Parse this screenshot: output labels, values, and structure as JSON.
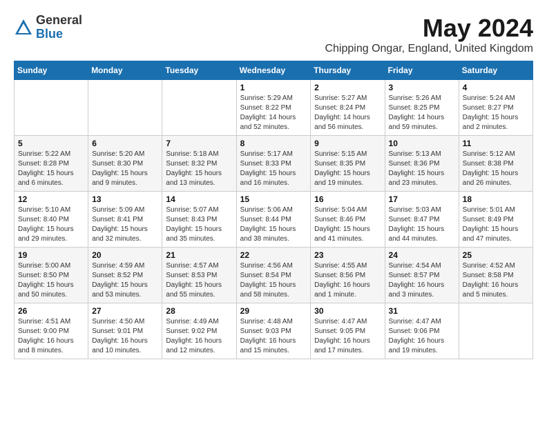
{
  "header": {
    "logo_general": "General",
    "logo_blue": "Blue",
    "title": "May 2024",
    "subtitle": "Chipping Ongar, England, United Kingdom"
  },
  "days_of_week": [
    "Sunday",
    "Monday",
    "Tuesday",
    "Wednesday",
    "Thursday",
    "Friday",
    "Saturday"
  ],
  "weeks": [
    [
      {
        "day": "",
        "info": ""
      },
      {
        "day": "",
        "info": ""
      },
      {
        "day": "",
        "info": ""
      },
      {
        "day": "1",
        "info": "Sunrise: 5:29 AM\nSunset: 8:22 PM\nDaylight: 14 hours\nand 52 minutes."
      },
      {
        "day": "2",
        "info": "Sunrise: 5:27 AM\nSunset: 8:24 PM\nDaylight: 14 hours\nand 56 minutes."
      },
      {
        "day": "3",
        "info": "Sunrise: 5:26 AM\nSunset: 8:25 PM\nDaylight: 14 hours\nand 59 minutes."
      },
      {
        "day": "4",
        "info": "Sunrise: 5:24 AM\nSunset: 8:27 PM\nDaylight: 15 hours\nand 2 minutes."
      }
    ],
    [
      {
        "day": "5",
        "info": "Sunrise: 5:22 AM\nSunset: 8:28 PM\nDaylight: 15 hours\nand 6 minutes."
      },
      {
        "day": "6",
        "info": "Sunrise: 5:20 AM\nSunset: 8:30 PM\nDaylight: 15 hours\nand 9 minutes."
      },
      {
        "day": "7",
        "info": "Sunrise: 5:18 AM\nSunset: 8:32 PM\nDaylight: 15 hours\nand 13 minutes."
      },
      {
        "day": "8",
        "info": "Sunrise: 5:17 AM\nSunset: 8:33 PM\nDaylight: 15 hours\nand 16 minutes."
      },
      {
        "day": "9",
        "info": "Sunrise: 5:15 AM\nSunset: 8:35 PM\nDaylight: 15 hours\nand 19 minutes."
      },
      {
        "day": "10",
        "info": "Sunrise: 5:13 AM\nSunset: 8:36 PM\nDaylight: 15 hours\nand 23 minutes."
      },
      {
        "day": "11",
        "info": "Sunrise: 5:12 AM\nSunset: 8:38 PM\nDaylight: 15 hours\nand 26 minutes."
      }
    ],
    [
      {
        "day": "12",
        "info": "Sunrise: 5:10 AM\nSunset: 8:40 PM\nDaylight: 15 hours\nand 29 minutes."
      },
      {
        "day": "13",
        "info": "Sunrise: 5:09 AM\nSunset: 8:41 PM\nDaylight: 15 hours\nand 32 minutes."
      },
      {
        "day": "14",
        "info": "Sunrise: 5:07 AM\nSunset: 8:43 PM\nDaylight: 15 hours\nand 35 minutes."
      },
      {
        "day": "15",
        "info": "Sunrise: 5:06 AM\nSunset: 8:44 PM\nDaylight: 15 hours\nand 38 minutes."
      },
      {
        "day": "16",
        "info": "Sunrise: 5:04 AM\nSunset: 8:46 PM\nDaylight: 15 hours\nand 41 minutes."
      },
      {
        "day": "17",
        "info": "Sunrise: 5:03 AM\nSunset: 8:47 PM\nDaylight: 15 hours\nand 44 minutes."
      },
      {
        "day": "18",
        "info": "Sunrise: 5:01 AM\nSunset: 8:49 PM\nDaylight: 15 hours\nand 47 minutes."
      }
    ],
    [
      {
        "day": "19",
        "info": "Sunrise: 5:00 AM\nSunset: 8:50 PM\nDaylight: 15 hours\nand 50 minutes."
      },
      {
        "day": "20",
        "info": "Sunrise: 4:59 AM\nSunset: 8:52 PM\nDaylight: 15 hours\nand 53 minutes."
      },
      {
        "day": "21",
        "info": "Sunrise: 4:57 AM\nSunset: 8:53 PM\nDaylight: 15 hours\nand 55 minutes."
      },
      {
        "day": "22",
        "info": "Sunrise: 4:56 AM\nSunset: 8:54 PM\nDaylight: 15 hours\nand 58 minutes."
      },
      {
        "day": "23",
        "info": "Sunrise: 4:55 AM\nSunset: 8:56 PM\nDaylight: 16 hours\nand 1 minute."
      },
      {
        "day": "24",
        "info": "Sunrise: 4:54 AM\nSunset: 8:57 PM\nDaylight: 16 hours\nand 3 minutes."
      },
      {
        "day": "25",
        "info": "Sunrise: 4:52 AM\nSunset: 8:58 PM\nDaylight: 16 hours\nand 5 minutes."
      }
    ],
    [
      {
        "day": "26",
        "info": "Sunrise: 4:51 AM\nSunset: 9:00 PM\nDaylight: 16 hours\nand 8 minutes."
      },
      {
        "day": "27",
        "info": "Sunrise: 4:50 AM\nSunset: 9:01 PM\nDaylight: 16 hours\nand 10 minutes."
      },
      {
        "day": "28",
        "info": "Sunrise: 4:49 AM\nSunset: 9:02 PM\nDaylight: 16 hours\nand 12 minutes."
      },
      {
        "day": "29",
        "info": "Sunrise: 4:48 AM\nSunset: 9:03 PM\nDaylight: 16 hours\nand 15 minutes."
      },
      {
        "day": "30",
        "info": "Sunrise: 4:47 AM\nSunset: 9:05 PM\nDaylight: 16 hours\nand 17 minutes."
      },
      {
        "day": "31",
        "info": "Sunrise: 4:47 AM\nSunset: 9:06 PM\nDaylight: 16 hours\nand 19 minutes."
      },
      {
        "day": "",
        "info": ""
      }
    ]
  ]
}
